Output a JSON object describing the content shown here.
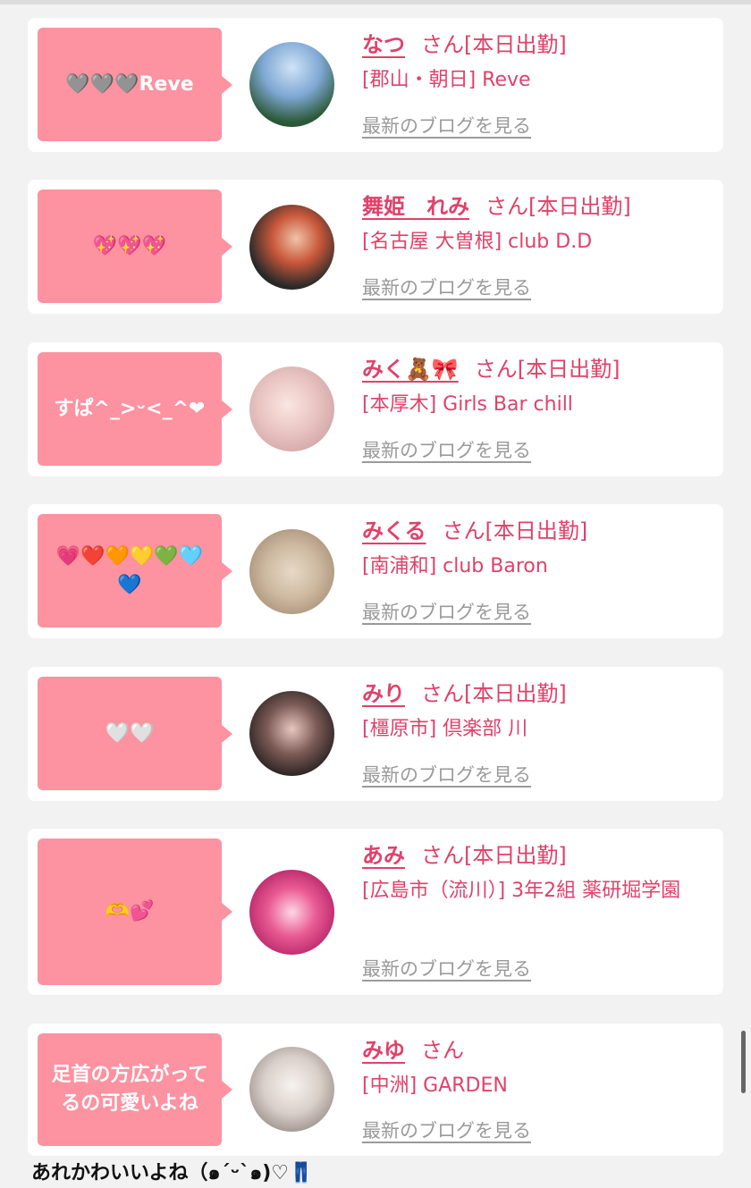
{
  "entries": [
    {
      "bubble": "🩶🩶🩶Reve",
      "name": "なつ",
      "suffix": "さん[本日出勤]",
      "location": "[郡山・朝日] Reve",
      "blog": "最新のブログを見る"
    },
    {
      "bubble": "💖💖💖",
      "name": "舞姫　れみ",
      "suffix": "さん[本日出勤]",
      "location": "[名古屋 大曽根] club D.D",
      "blog": "最新のブログを見る"
    },
    {
      "bubble": "すぱ^_>ᵕ<_^❤",
      "name": "みく🧸🎀",
      "suffix": "さん[本日出勤]",
      "location": "[本厚木] Girls Bar chill",
      "blog": "最新のブログを見る"
    },
    {
      "bubble": "💗❤️🧡💛💚🩵💙",
      "name": "みくる",
      "suffix": "さん[本日出勤]",
      "location": "[南浦和] club Baron",
      "blog": "最新のブログを見る"
    },
    {
      "bubble": "🤍🤍",
      "name": "みり",
      "suffix": "さん[本日出勤]",
      "location": "[橿原市] 倶楽部 川",
      "blog": "最新のブログを見る"
    },
    {
      "bubble": "🫶💕",
      "name": "あみ",
      "suffix": "さん[本日出勤]",
      "location": "[広島市（流川）] 3年2組 薬研堀学園",
      "blog": "最新のブログを見る"
    },
    {
      "bubble": "足首の方広がってるの可愛いよね",
      "name": "みゆ",
      "suffix": "さん",
      "location": "[中洲] GARDEN",
      "blog": "最新のブログを見る"
    }
  ],
  "footer_text": "あれかわいいよね（๑´ᵕ`๑)♡👖",
  "colors": {
    "accent": "#e0416a",
    "bubble": "#fd92a0",
    "link_gray": "#9a9a9a"
  }
}
